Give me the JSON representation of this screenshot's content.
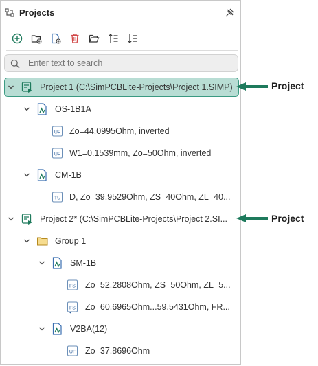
{
  "panel": {
    "title": "Projects",
    "search": {
      "placeholder": "Enter text to search",
      "value": ""
    },
    "toolbar": [
      "add-circle-icon",
      "new-folder-icon",
      "new-file-icon",
      "delete-icon",
      "open-folder-icon",
      "sort-ascending-icon",
      "sort-descending-icon"
    ]
  },
  "tree": {
    "project1": "Project 1 (C:\\SimPCBLite-Projects\\Project 1.SIMP)",
    "os1b1a": "OS-1B1A",
    "os1b1a_item1": "Zo=44.0995Ohm, inverted",
    "os1b1a_item2": "W1=0.1539mm, Zo=50Ohm, inverted",
    "cm1b": "CM-1B",
    "cm1b_item1": "D, Zo=39.9529Ohm, ZS=40Ohm, ZL=40...",
    "project2": "Project 2* (C:\\SimPCBLite-Projects\\Project 2.SI...",
    "group1": "Group 1",
    "sm1b": "SM-1B",
    "sm1b_item1": "Zo=52.2808Ohm, ZS=50Ohm, ZL=5...",
    "sm1b_item2": "Zo=60.6965Ohm...59.5431Ohm, FR...",
    "v2ba": "V2BA(12)",
    "v2ba_item1": "Zo=37.8696Ohm",
    "badges": {
      "uf": "UF",
      "tu": "TU",
      "fs": "FS"
    }
  },
  "callouts": {
    "first": "Project",
    "second": "Project"
  },
  "colors": {
    "accent": "#1e7a5c",
    "selection": "#b8ddd4",
    "selection_border": "#3b9a82",
    "delete": "#d24a4a",
    "folder": "#e0b34a"
  }
}
